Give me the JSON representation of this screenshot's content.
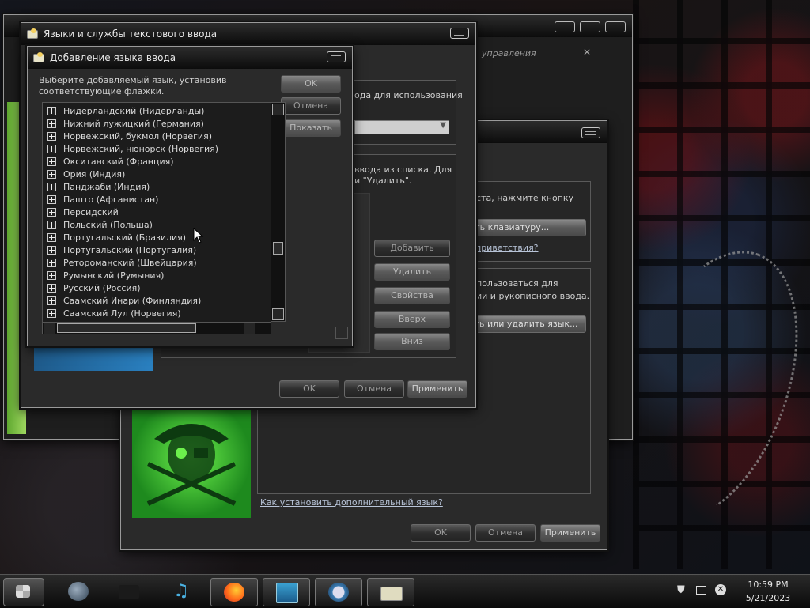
{
  "bg_window": {
    "header_fragment": "управления",
    "hint_line1": "ста, нажмите кнопку",
    "keyboard_button": "лить клавиатуру...",
    "greeting_link": "приветствия?",
    "use_line1": "пользоваться для",
    "use_line2": "ии и рукописного ввода.",
    "add_remove_button": "вить или удалить язык...",
    "install_link": "Как установить дополнительный язык?",
    "ok": "OK",
    "cancel": "Отмена",
    "apply": "Применить"
  },
  "text_services": {
    "title": "Языки и службы текстового ввода",
    "default_lang_label": "ода для использования",
    "list_hint_line1": "ввода из списка. Для",
    "list_hint_line2": "и \"Удалить\".",
    "add": "Добавить",
    "remove": "Удалить",
    "properties": "Свойства",
    "up": "Вверх",
    "down": "Вниз",
    "ok": "OK",
    "cancel": "Отмена",
    "apply": "Применить"
  },
  "add_lang_dialog": {
    "title": "Добавление языка ввода",
    "instruction_line1": "Выберите добавляемый язык, установив",
    "instruction_line2": "соответствующие флажки.",
    "ok": "OK",
    "cancel": "Отмена",
    "show": "Показать",
    "languages": [
      "Нидерландский (Нидерланды)",
      "Нижний лужицкий (Германия)",
      "Норвежский, букмол (Норвегия)",
      "Норвежский, нюнорск (Норвегия)",
      "Окситанский (Франция)",
      "Ория (Индия)",
      "Панджаби (Индия)",
      "Пашто (Афганистан)",
      "Персидский",
      "Польский (Польша)",
      "Португальский (Бразилия)",
      "Португальский (Португалия)",
      "Ретороманский (Швейцария)",
      "Румынский (Румыния)",
      "Русский (Россия)",
      "Саамский Инари (Финляндия)",
      "Саамский Лул (Норвегия)"
    ]
  },
  "taskbar": {
    "time": "10:59 PM",
    "date": "5/21/2023"
  }
}
